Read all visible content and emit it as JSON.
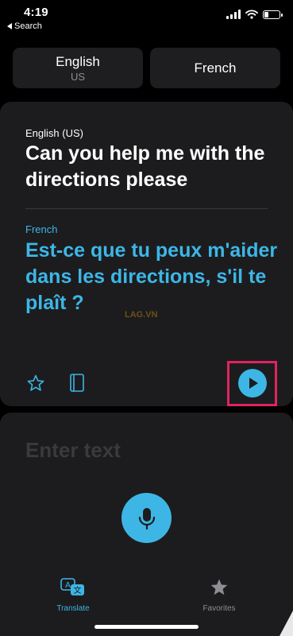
{
  "status_bar": {
    "time": "4:19",
    "back_label": "Search"
  },
  "languages": {
    "source": {
      "name": "English",
      "region": "US"
    },
    "target": {
      "name": "French"
    }
  },
  "translation": {
    "source_label": "English (US)",
    "source_text": "Can you help me with the directions please",
    "target_label": "French",
    "target_text": "Est-ce que tu peux m'aider dans les directions, s'il te plaît ?"
  },
  "watermark": "LAG.VN",
  "input": {
    "placeholder": "Enter text"
  },
  "tabs": [
    {
      "label": "Translate",
      "active": true
    },
    {
      "label": "Favorites",
      "active": false
    }
  ],
  "colors": {
    "accent": "#3db6e6",
    "highlight": "#e0245e",
    "card": "#1c1c1e"
  },
  "icons": [
    "star-outline-icon",
    "dictionary-book-icon",
    "play-icon",
    "microphone-icon",
    "translate-icon",
    "star-filled-icon"
  ]
}
